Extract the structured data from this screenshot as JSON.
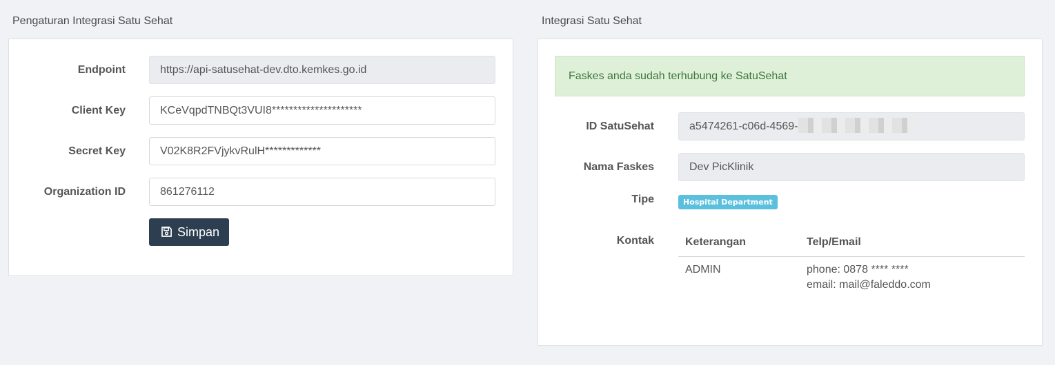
{
  "left": {
    "title": "Pengaturan Integrasi Satu Sehat",
    "fields": [
      {
        "label": "Endpoint",
        "value": "https://api-satusehat-dev.dto.kemkes.go.id",
        "readonly": true
      },
      {
        "label": "Client Key",
        "value": "KCeVqpdTNBQt3VUI8*********************",
        "readonly": false
      },
      {
        "label": "Secret Key",
        "value": "V02K8R2FVjykvRulH*************",
        "readonly": false
      },
      {
        "label": "Organization ID",
        "value": "861276112",
        "readonly": false
      }
    ],
    "save_button": {
      "label": "Simpan",
      "icon": "floppy-disk-icon"
    }
  },
  "right": {
    "title": "Integrasi Satu Sehat",
    "alert": "Faskes anda sudah terhubung ke SatuSehat",
    "id_label": "ID SatuSehat",
    "id_value": "a5474261-c06d-4569-",
    "nama_label": "Nama Faskes",
    "nama_value": "Dev PicKlinik",
    "tipe_label": "Tipe",
    "tipe_value": "Hospital Department",
    "kontak_label": "Kontak",
    "kontak_table": {
      "headers": [
        "Keterangan",
        "Telp/Email"
      ],
      "rows": [
        {
          "keterangan": "ADMIN",
          "phone": "phone: 0878 **** ****",
          "email": "email: mail@faleddo.com"
        }
      ]
    }
  },
  "colors": {
    "button_bg": "#2c3e50",
    "alert_bg": "#dff0d8",
    "alert_text": "#3c763d",
    "badge_bg": "#5bc0de"
  }
}
